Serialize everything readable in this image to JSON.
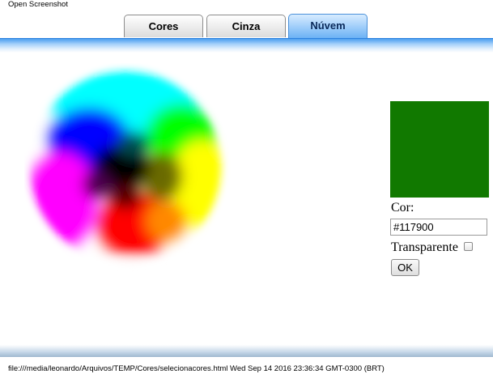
{
  "header": {
    "title": "Open Screenshot"
  },
  "tabs": [
    {
      "label": "Cores",
      "active": false
    },
    {
      "label": "Cinza",
      "active": false
    },
    {
      "label": "Núvem",
      "active": true
    }
  ],
  "picker": {
    "selected_color": "#117900",
    "cor_label": "Cor:",
    "hex_value": "#117900",
    "transparent_label": "Transparente",
    "transparent_checked": false,
    "ok_label": "OK"
  },
  "footer": {
    "text": "file:///media/leonardo/Arquivos/TEMP/Cores/selecionacores.html Wed Sep 14 2016 23:36:34 GMT-0300 (BRT)"
  },
  "colors": {
    "accent": "#6cb2f5",
    "tab_band": "#4b9ff0"
  }
}
